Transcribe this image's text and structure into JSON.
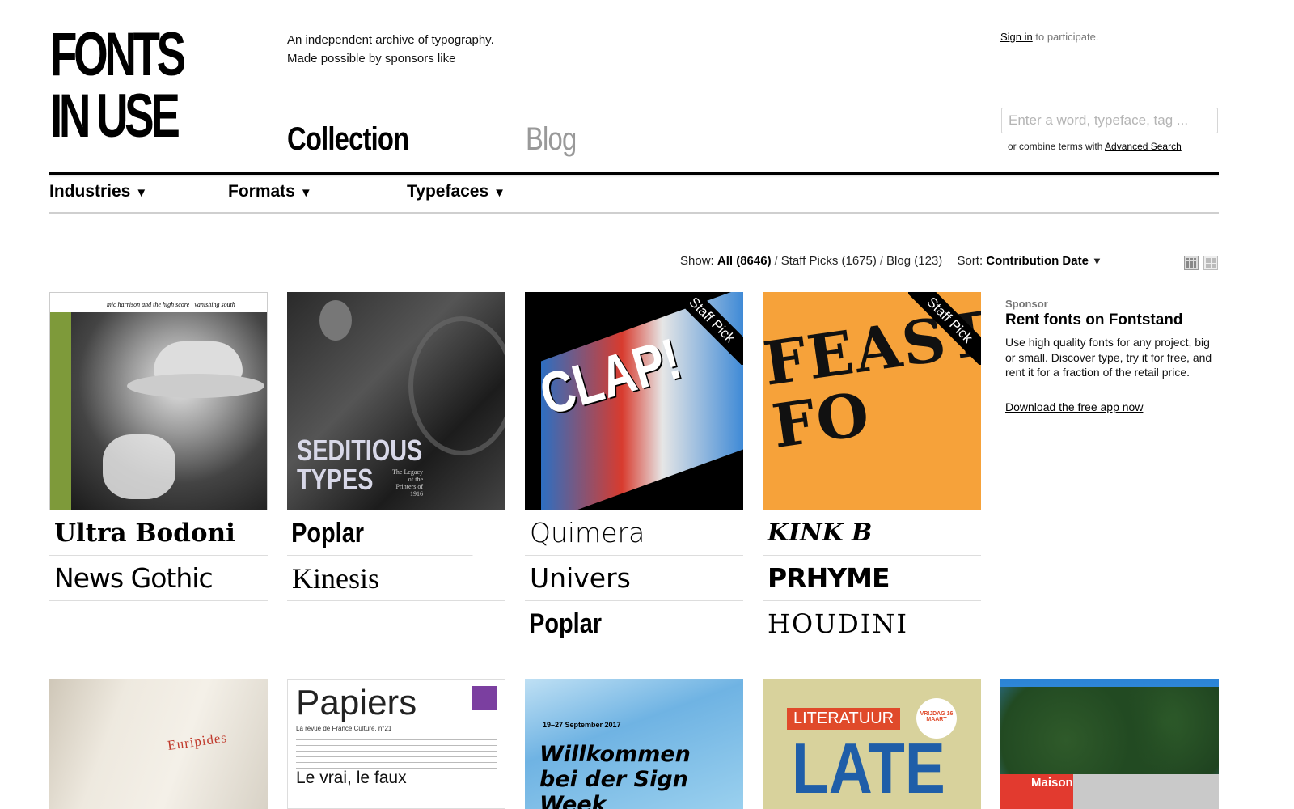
{
  "logo": {
    "line1": "FONTS",
    "line2": "IN USE"
  },
  "tagline": {
    "line1": "An independent archive of typography.",
    "line2": "Made possible by sponsors like"
  },
  "tabs": [
    {
      "label": "Collection"
    },
    {
      "label": "Blog"
    }
  ],
  "signin": {
    "link": "Sign in",
    "text": "to participate."
  },
  "search": {
    "placeholder": "Enter a word, typeface, tag ...",
    "hint": "or combine terms with",
    "adv_link": "Advanced Search"
  },
  "nav": [
    {
      "label": "Industries"
    },
    {
      "label": "Formats"
    },
    {
      "label": "Typefaces"
    }
  ],
  "filters": {
    "show_label": "Show:",
    "all": "All (8646)",
    "staff": "Staff Picks (1675)",
    "blog": "Blog (123)",
    "sort_label": "Sort:",
    "sort_value": "Contribution Date"
  },
  "cards": [
    {
      "thumb_text": "mic harrison and the high score | vanishing south",
      "fonts": [
        "Ultra Bodoni",
        "News Gothic"
      ],
      "staff_pick": false
    },
    {
      "thumb_text": "SEDITIOUS TYPES",
      "thumb_sub": "The Legacy of the Printers of 1916",
      "fonts": [
        "Poplar",
        "Kinesis"
      ],
      "staff_pick": false
    },
    {
      "thumb_text": "CLAP!",
      "fonts": [
        "Quimera",
        "Univers",
        "Poplar"
      ],
      "staff_pick": true
    },
    {
      "thumb_text": "FEAST FO",
      "fonts": [
        "KINK B",
        "PRHYME",
        "HOUDINI"
      ],
      "staff_pick": true
    }
  ],
  "staff_pick_label": "Staff Pick",
  "sponsor": {
    "label": "Sponsor",
    "title": "Rent fonts on Fontstand",
    "body": "Use high quality fonts for any project, big or small. Discover type, try it for free, and rent it for a fraction of the retail price.",
    "link": "Download the free app now"
  },
  "row2": [
    {
      "thumb_text": "Euripides"
    },
    {
      "thumb_text": "Papiers",
      "thumb_sub": "La revue de France Culture, n°21",
      "thumb_sub2": "Le vrai, le faux"
    },
    {
      "thumb_text": "Willkommen bei der Sign Week",
      "thumb_sub": "19–27 September 2017"
    },
    {
      "thumb_text": "LATE",
      "thumb_sub": "LITERATUUR",
      "badge": "VRIJDAG 16 MAART"
    },
    {
      "thumb_text": "Maison"
    }
  ]
}
